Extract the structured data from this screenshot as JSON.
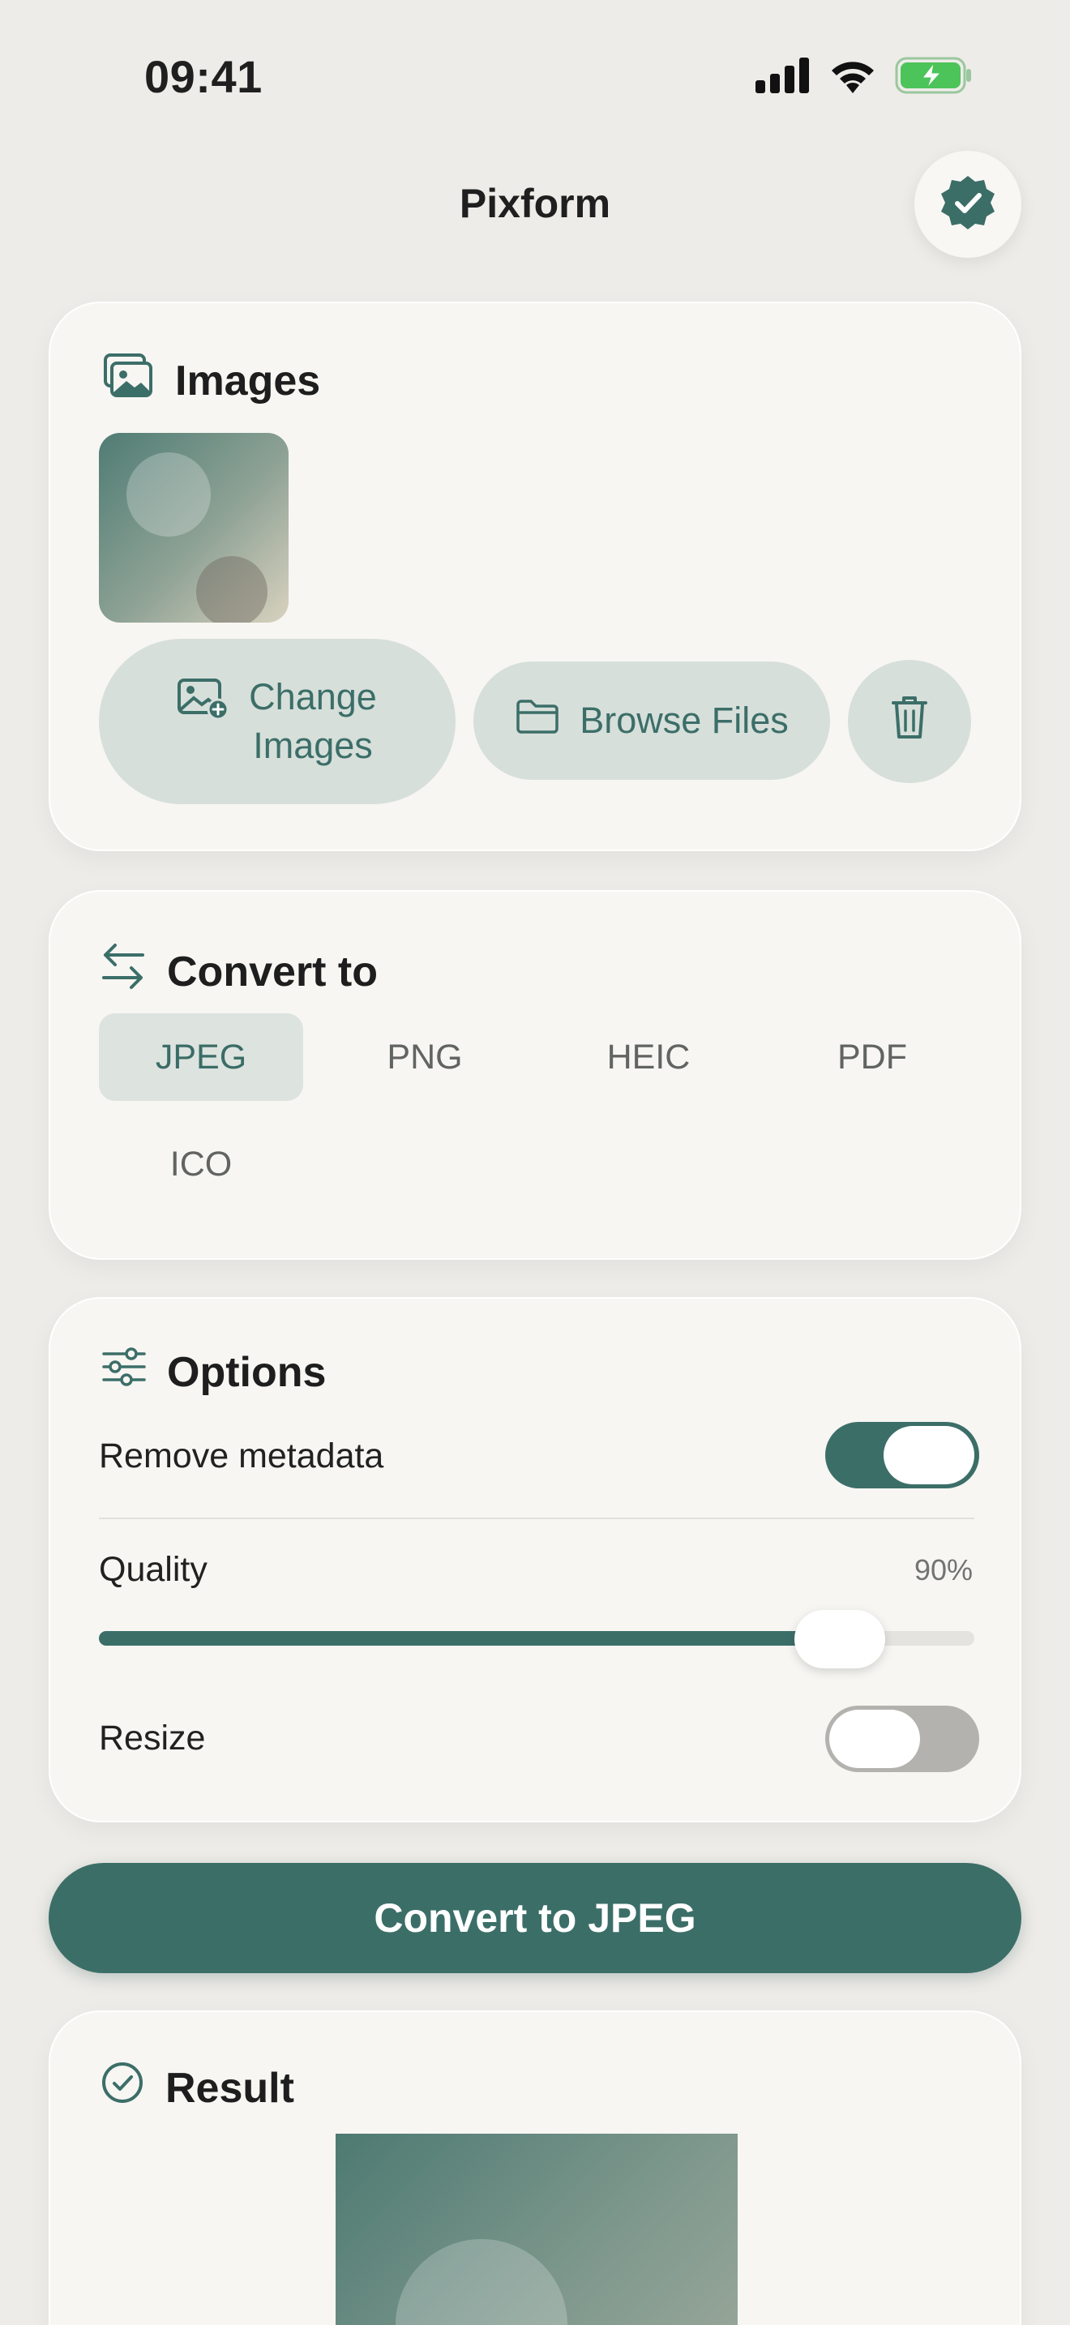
{
  "status_bar": {
    "time": "09:41"
  },
  "app": {
    "title": "Pixform"
  },
  "images_card": {
    "title": "Images",
    "change_label_line1": "Change",
    "change_label_line2": "Images",
    "browse_label": "Browse Files"
  },
  "convert_card": {
    "title": "Convert to",
    "formats": [
      "JPEG",
      "PNG",
      "HEIC",
      "PDF",
      "ICO"
    ],
    "selected": "JPEG"
  },
  "options_card": {
    "title": "Options",
    "remove_metadata_label": "Remove metadata",
    "remove_metadata_on": true,
    "quality_label": "Quality",
    "quality_value_text": "90%",
    "quality_value": 0.9,
    "resize_label": "Resize",
    "resize_on": false
  },
  "convert_button": {
    "label": "Convert to JPEG"
  },
  "result_card": {
    "title": "Result"
  },
  "colors": {
    "accent": "#3c6e68",
    "background": "#eeece8",
    "card": "#f7f6f2",
    "toggle_off": "#b3b2ae",
    "battery_green": "#4cc45a"
  },
  "icons": {
    "signal": "cellular-signal-icon",
    "wifi": "wifi-icon",
    "battery": "battery-charging-icon",
    "verified": "verified-badge-icon",
    "images": "images-icon",
    "add_image": "add-image-icon",
    "folder": "folder-icon",
    "trash": "trash-icon",
    "convert": "arrows-swap-icon",
    "options": "sliders-icon",
    "result": "check-circle-icon"
  }
}
